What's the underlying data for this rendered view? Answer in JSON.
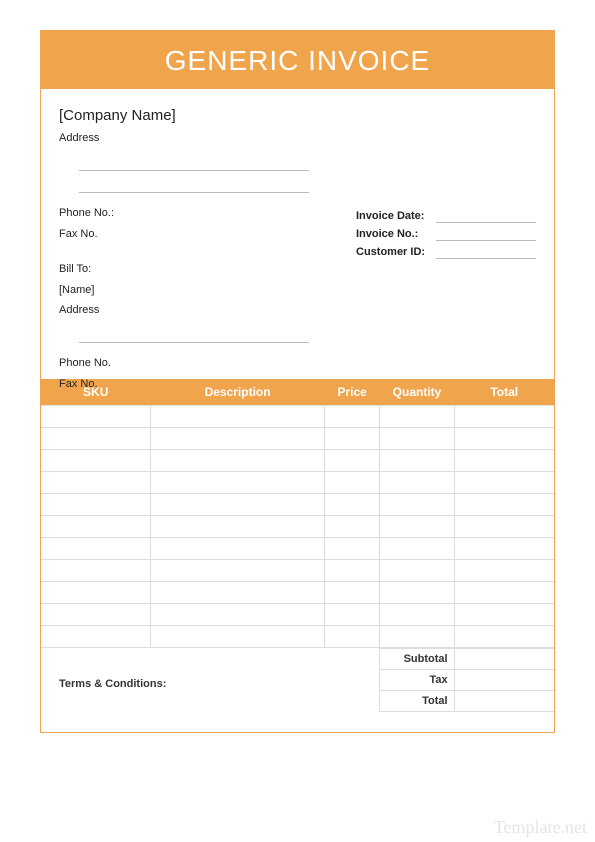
{
  "title": "GENERIC INVOICE",
  "company": {
    "name": "[Company Name]",
    "address_label": "Address",
    "phone_label": "Phone No.:",
    "fax_label": "Fax No."
  },
  "billto": {
    "heading": "Bill To:",
    "name": "[Name]",
    "address_label": "Address",
    "phone_label": "Phone No.",
    "fax_label": "Fax No."
  },
  "meta": {
    "invoice_date_label": "Invoice Date:",
    "invoice_no_label": "Invoice No.:",
    "customer_id_label": "Customer ID:"
  },
  "columns": {
    "sku": "SKU",
    "description": "Description",
    "price": "Price",
    "quantity": "Quantity",
    "total": "Total"
  },
  "rows": [
    "",
    "",
    "",
    "",
    "",
    "",
    "",
    "",
    "",
    "",
    ""
  ],
  "totals": {
    "subtotal_label": "Subtotal",
    "tax_label": "Tax",
    "total_label": "Total"
  },
  "terms_label": "Terms & Conditions:",
  "watermark": "Template.net"
}
